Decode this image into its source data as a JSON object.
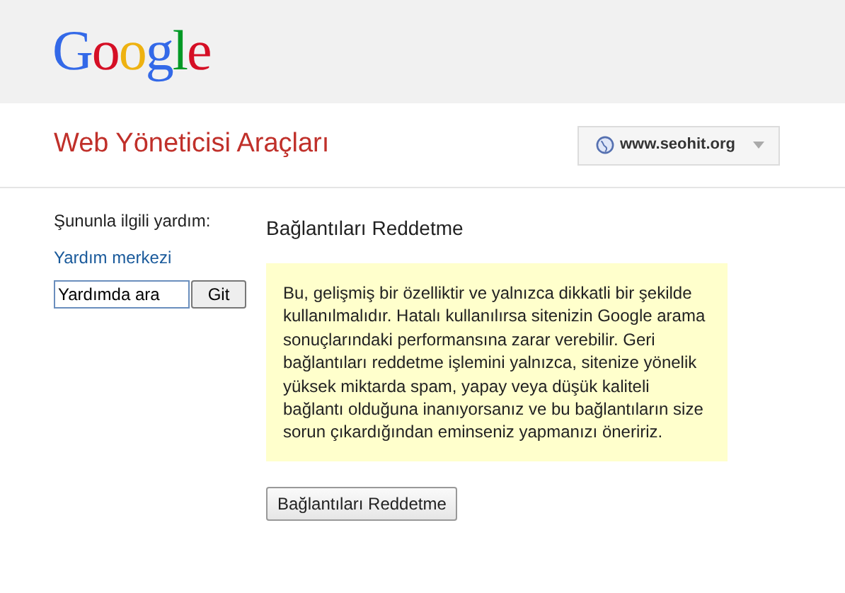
{
  "logo": "Google",
  "title": "Web Yöneticisi Araçları",
  "site_selector": {
    "label": "www.seohit.org"
  },
  "sidebar": {
    "heading": "Şununla ilgili yardım:",
    "link": "Yardım merkezi",
    "search": {
      "value": "Yardımda ara"
    },
    "button": "Git"
  },
  "main": {
    "heading": "Bağlantıları Reddetme",
    "warning": "Bu, gelişmiş bir özelliktir ve yalnızca dikkatli bir şekilde kullanılmalıdır. Hatalı kullanılırsa sitenizin Google arama sonuçlarındaki performansına zarar verebilir. Geri bağlantıları reddetme işlemini yalnızca, sitenize yönelik yüksek miktarda spam, yapay veya düşük kaliteli bağlantı olduğuna inanıyorsanız ve bu bağlantıların size sorun çıkardığından eminseniz yapmanızı öneririz.",
    "button": "Bağlantıları Reddetme"
  }
}
